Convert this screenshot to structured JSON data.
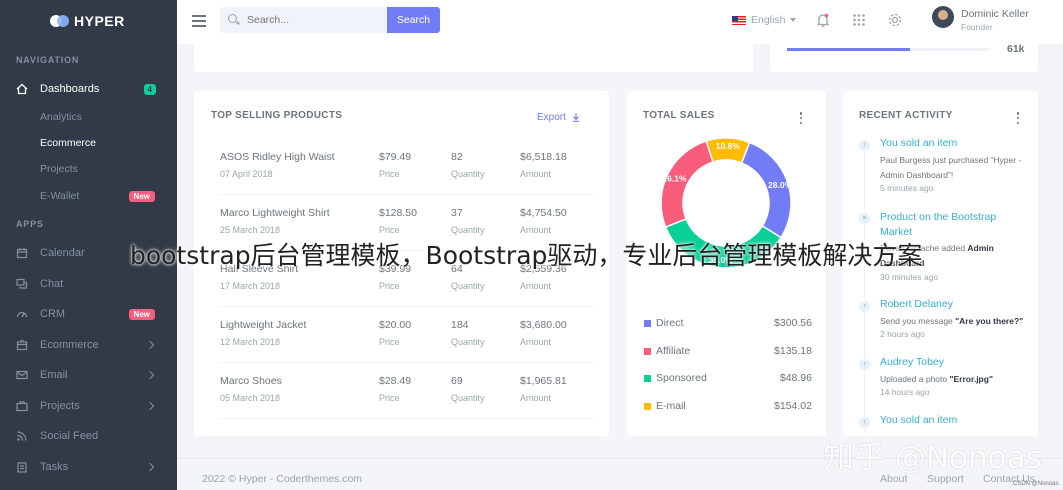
{
  "brand": {
    "name": "HYPER"
  },
  "sidebar": {
    "nav_title": "NAVIGATION",
    "apps_title": "APPS",
    "dashboards": {
      "label": "Dashboards",
      "badge": "4"
    },
    "sub_items": [
      "Analytics",
      "Ecommerce",
      "Projects",
      "E-Wallet"
    ],
    "ewallet_badge": "New",
    "apps": [
      {
        "label": "Calendar",
        "icon": "calendar-icon"
      },
      {
        "label": "Chat",
        "icon": "chat-icon"
      },
      {
        "label": "CRM",
        "icon": "crm-icon",
        "badge": "New"
      },
      {
        "label": "Ecommerce",
        "icon": "cart-icon"
      },
      {
        "label": "Email",
        "icon": "email-icon"
      },
      {
        "label": "Projects",
        "icon": "briefcase-icon"
      },
      {
        "label": "Social Feed",
        "icon": "rss-icon"
      },
      {
        "label": "Tasks",
        "icon": "clipboard-icon"
      }
    ]
  },
  "topbar": {
    "search_placeholder": "Search...",
    "search_button": "Search",
    "language": "English",
    "user_name": "Dominic Keller",
    "user_role": "Founder"
  },
  "top_cards": {
    "progress_value": "61k",
    "progress_fraction": 0.61
  },
  "top_selling": {
    "title": "TOP SELLING PRODUCTS",
    "export_label": "Export",
    "products": [
      {
        "name": "ASOS Ridley High Waist",
        "date": "07 April 2018",
        "price": "$79.49",
        "quantity": "82",
        "amount": "$6,518.18"
      },
      {
        "name": "Marco Lightweight Shirt",
        "date": "25 March 2018",
        "price": "$128.50",
        "quantity": "37",
        "amount": "$4,754.50"
      },
      {
        "name": "Half Sleeve Shirt",
        "date": "17 March 2018",
        "price": "$39.99",
        "quantity": "64",
        "amount": "$2,559.36"
      },
      {
        "name": "Lightweight Jacket",
        "date": "12 March 2018",
        "price": "$20.00",
        "quantity": "184",
        "amount": "$3,680.00"
      },
      {
        "name": "Marco Shoes",
        "date": "05 March 2018",
        "price": "$28.49",
        "quantity": "69",
        "amount": "$1,965.81"
      }
    ],
    "price_label": "Price",
    "quantity_label": "Quantity",
    "amount_label": "Amount"
  },
  "total_sales": {
    "title": "TOTAL SALES",
    "legend": [
      {
        "name": "Direct",
        "value": "$300.56",
        "color": "#727cf5"
      },
      {
        "name": "Affiliate",
        "value": "$135.18",
        "color": "#fa5c7c"
      },
      {
        "name": "Sponsored",
        "value": "$48.96",
        "color": "#0acf97"
      },
      {
        "name": "E-mail",
        "value": "$154.02",
        "color": "#ffbc00"
      }
    ]
  },
  "chart_data": {
    "type": "pie",
    "title": "TOTAL SALES",
    "slices": [
      {
        "name": "Direct",
        "value": 28.0,
        "label": "28.0%",
        "color": "#727cf5"
      },
      {
        "name": "Sponsored",
        "value": 35.0,
        "label": "35.0%",
        "color": "#0acf97"
      },
      {
        "name": "Affiliate",
        "value": 26.1,
        "label": "26.1%",
        "color": "#fa5c7c"
      },
      {
        "name": "E-mail",
        "value": 10.8,
        "label": "10.8%",
        "color": "#ffbc00"
      }
    ]
  },
  "recent_activity": {
    "title": "RECENT ACTIVITY",
    "items": [
      {
        "title": "You sold an item",
        "desc_pre": "Paul Burgess just purchased “Hyper - Admin Dashboard”!",
        "desc_bold": "",
        "time": "5 minutes ago"
      },
      {
        "title": "Product on the Bootstrap Market",
        "desc_pre": "Dave Gamache added ",
        "desc_bold": "Admin Dashboard",
        "time": "30 minutes ago"
      },
      {
        "title": "Robert Delaney",
        "desc_pre": "Send you message ",
        "desc_bold": "\"Are you there?\"",
        "time": "2 hours ago"
      },
      {
        "title": "Audrey Tobey",
        "desc_pre": "Uploaded a photo ",
        "desc_bold": "\"Error.jpg\"",
        "time": "14 hours ago"
      },
      {
        "title": "You sold an item",
        "desc_pre": "",
        "desc_bold": "",
        "time": ""
      }
    ]
  },
  "footer": {
    "copyright": "2022 © Hyper - Coderthemes.com",
    "links": [
      "About",
      "Support",
      "Contact Us"
    ]
  },
  "overlay_caption": "bootstrap后台管理模板，Bootstrap驱动，专业后台管理模板解决方案",
  "watermark": "知乎 @Nonoas",
  "watermark_small": "CSDN @Nonoas"
}
